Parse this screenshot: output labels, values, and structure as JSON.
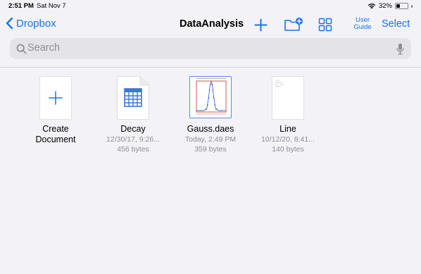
{
  "status_bar": {
    "time": "2:51 PM",
    "date": "Sat Nov 7",
    "battery_percent": "32%",
    "battery_level": 0.32
  },
  "nav": {
    "back_label": "Dropbox",
    "title": "DataAnalysis",
    "user_guide_label": "User\nGuide",
    "select_label": "Select",
    "accent_color": "#1a73e8"
  },
  "search": {
    "placeholder": "Search",
    "value": ""
  },
  "files": [
    {
      "name": "Create\nDocument",
      "date": "",
      "size": "",
      "icon": "plus-icon"
    },
    {
      "name": "Decay",
      "date": "12/30/17, 9:26...",
      "size": "456 bytes",
      "icon": "spreadsheet-icon"
    },
    {
      "name": "Gauss.daes",
      "date": "Today, 2:49 PM",
      "size": "359 bytes",
      "icon": "chart-thumbnail"
    },
    {
      "name": "Line",
      "date": "10/12/20, 8:41...",
      "size": "140 bytes",
      "icon": "document-thumbnail"
    }
  ]
}
